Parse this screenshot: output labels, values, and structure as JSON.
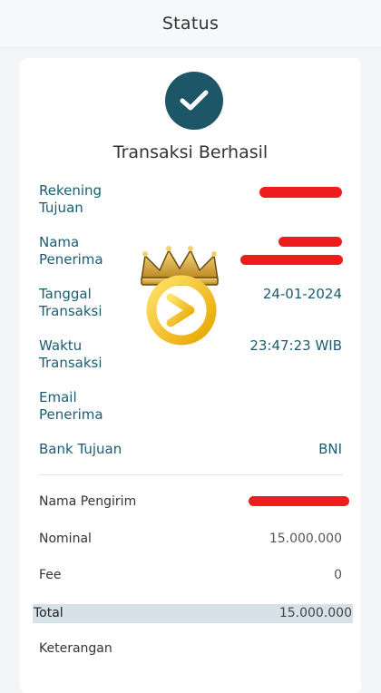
{
  "header": {
    "title": "Status"
  },
  "status": {
    "title": "Transaksi Berhasil",
    "icon": "check-circle-icon",
    "color": "#1d5767"
  },
  "recipient": {
    "rekening_tujuan": {
      "label_line1": "Rekening",
      "label_line2": "Tujuan"
    },
    "nama_penerima": {
      "label_line1": "Nama",
      "label_line2": "Penerima"
    },
    "tanggal_transaksi": {
      "label_line1": "Tanggal",
      "label_line2": "Transaksi",
      "value": "24-01-2024"
    },
    "waktu_transaksi": {
      "label_line1": "Waktu",
      "label_line2": "Transaksi",
      "value": "23:47:23 WIB"
    },
    "email_penerima": {
      "label_line1": "Email",
      "label_line2": "Penerima",
      "value": ""
    },
    "bank_tujuan": {
      "label": "Bank Tujuan",
      "value": "BNI"
    }
  },
  "sender": {
    "nama_pengirim": {
      "label": "Nama Pengirim"
    },
    "nominal": {
      "label": "Nominal",
      "value": "15.000.000"
    },
    "fee": {
      "label": "Fee",
      "value": "0"
    },
    "total": {
      "label": "Total",
      "value": "15.000.000"
    },
    "keterangan": {
      "label": "Keterangan",
      "value": ""
    }
  },
  "colors": {
    "accent": "#1a5d72",
    "redaction": "#ee1c1c",
    "total_bg": "#d6e2e8"
  }
}
